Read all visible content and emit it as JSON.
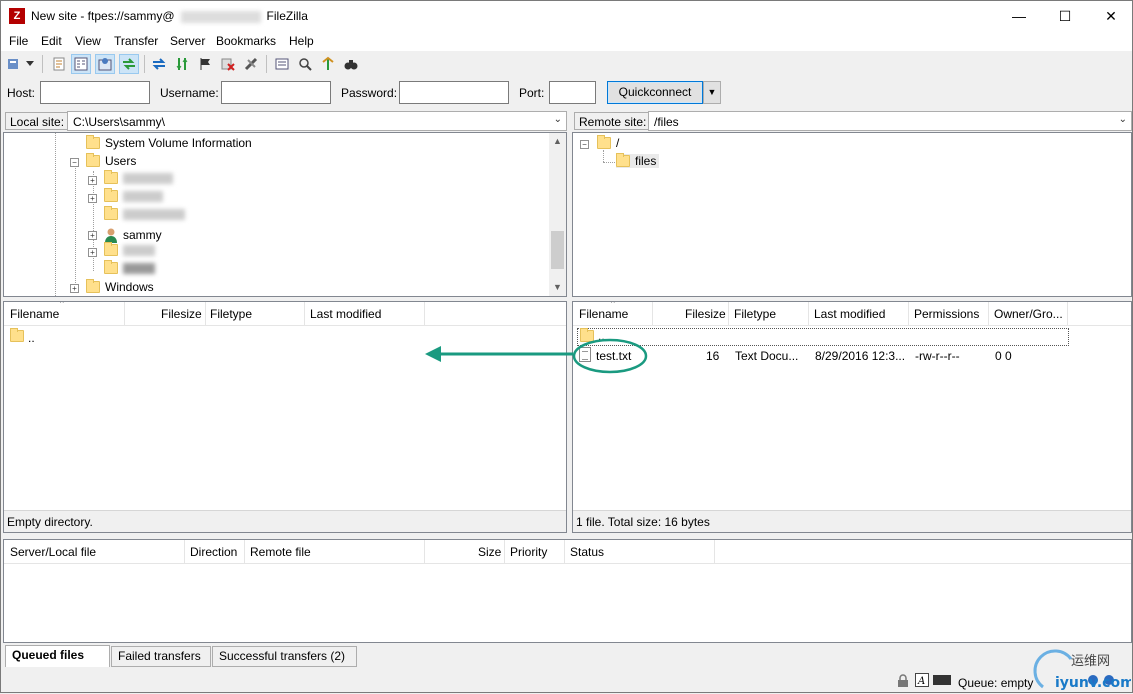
{
  "window": {
    "title_prefix": "New site - ftpes://sammy@",
    "title_suffix": "FileZilla",
    "minimize": "—",
    "maximize": "☐",
    "close": "✕"
  },
  "menu": [
    "File",
    "Edit",
    "View",
    "Transfer",
    "Server",
    "Bookmarks",
    "Help"
  ],
  "quickconnect": {
    "host_label": "Host:",
    "username_label": "Username:",
    "password_label": "Password:",
    "port_label": "Port:",
    "host_value": "",
    "username_value": "",
    "password_value": "",
    "port_value": "",
    "button_label": "Quickconnect",
    "dropdown": "▼"
  },
  "local": {
    "site_label": "Local site:",
    "path": "C:\\Users\\sammy\\",
    "tree": {
      "system_volume": "System Volume Information",
      "users": "Users",
      "sammy": "sammy",
      "windows": "Windows"
    },
    "columns": [
      "Filename",
      "Filesize",
      "Filetype",
      "Last modified"
    ],
    "files": [
      {
        "name": ".."
      }
    ],
    "status": "Empty directory."
  },
  "remote": {
    "site_label": "Remote site:",
    "path": "/files",
    "tree": {
      "root": "/",
      "files": "files"
    },
    "columns": [
      "Filename",
      "Filesize",
      "Filetype",
      "Last modified",
      "Permissions",
      "Owner/Gro..."
    ],
    "files": [
      {
        "name": "..",
        "size": "",
        "type": "",
        "modified": "",
        "perms": "",
        "owner": ""
      },
      {
        "name": "test.txt",
        "size": "16",
        "type": "Text Docu...",
        "modified": "8/29/2016 12:3...",
        "perms": "-rw-r--r--",
        "owner": "0 0"
      }
    ],
    "status": "1 file. Total size: 16 bytes"
  },
  "queue": {
    "columns": [
      "Server/Local file",
      "Direction",
      "Remote file",
      "Size",
      "Priority",
      "Status"
    ],
    "tabs": [
      "Queued files",
      "Failed transfers",
      "Successful transfers (2)"
    ],
    "status": "Queue: empty"
  },
  "colors": {
    "annotation": "#1a9a80",
    "accent": "#0078d7"
  }
}
